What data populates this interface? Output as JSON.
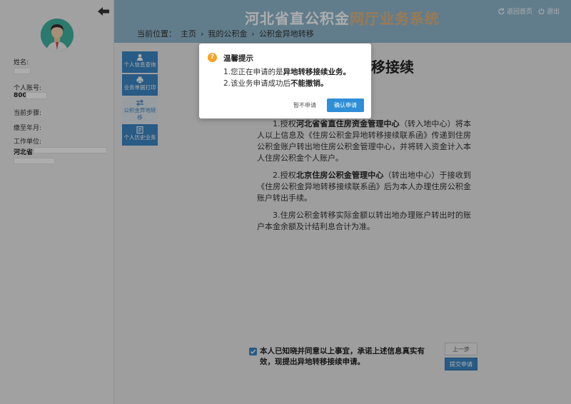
{
  "sidebar": {
    "labels": {
      "name": "姓名:",
      "account": "个人账号:",
      "account_prefix": "800",
      "current_step": "当前步骤:",
      "paid_until": "缴至年月:",
      "work_unit": "工作单位:",
      "work_unit_prefix": "河北省"
    }
  },
  "header": {
    "title_part1": "河北省直公积金",
    "title_part2": "网厅业务系统",
    "return_home": "返回首页",
    "logout": "退出",
    "breadcrumb": [
      "当前位置：",
      "主页",
      "›",
      "我的公积金",
      "›",
      "公积金异地转移"
    ]
  },
  "menu": {
    "items": [
      {
        "label": "个人信息查询",
        "icon": "person-icon"
      },
      {
        "label": "业务单据打印",
        "icon": "print-icon"
      },
      {
        "label": "公积金异地转移",
        "icon": "transfer-icon"
      },
      {
        "label": "个人历史业务",
        "icon": "history-icon"
      }
    ]
  },
  "main": {
    "title_visible": "移接续",
    "terms": {
      "p1_a": "1.授权",
      "p1_b": "河北省省直住房资金管理中心",
      "p1_c": "（转入地中心）将本人以上信息及《住房公积金异地转移接续联系函》传递到住房公积金账户转出地住房公积金管理中心，并将转入资金计入本人住房公积金个人账户。",
      "p2_a": "2.授权",
      "p2_b": "北京住房公积金管理中心",
      "p2_c": "（转出地中心）于接收到《住房公积金异地转移接续联系函》后为本人办理住房公积金账户转出手续。",
      "p3": "3.住房公积金转移实际金额以转出地办理账户转出时的账户本金余额及计结利息合计为准。"
    },
    "agree_text": "本人已知晓并同意以上事宜，承诺上述信息真实有效，现提出异地转移接续申请。",
    "prev_button": "上一步",
    "submit_button": "提交申请"
  },
  "modal": {
    "icon_glyph": "?",
    "title": "温馨提示",
    "line1_a": "1.您正在申请的是",
    "line1_b": "异地转移接续业务。",
    "line2_a": "2.该业务申请成功后",
    "line2_b": "不能撤销。",
    "cancel": "暂不申请",
    "confirm": "确认申请"
  },
  "colors": {
    "header_bg": "#8fb8cf",
    "menu_blue": "#3b87c5",
    "confirm_blue": "#2f8ed8",
    "warning_orange": "#f7a223"
  }
}
